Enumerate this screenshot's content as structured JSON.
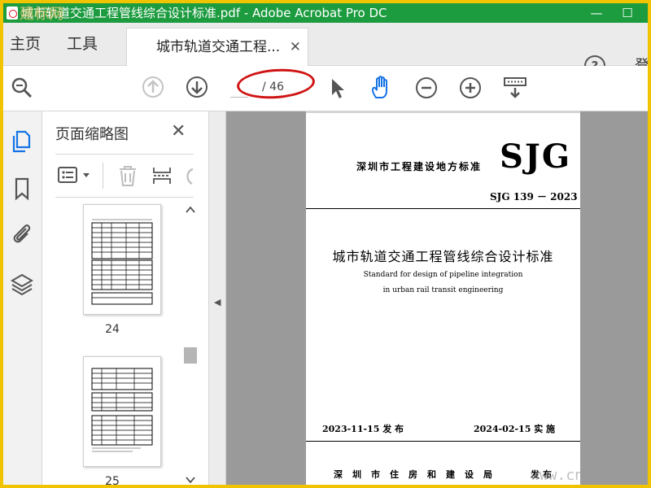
{
  "window": {
    "title": "城市轨道交通工程管线综合设计标准.pdf - Adobe Acrobat Pro DC",
    "watermark_overlay": "建标网",
    "minimize_glyph": "—",
    "maximize_glyph": "☐"
  },
  "tabs": {
    "home": "主页",
    "tools": "工具",
    "document": "城市轨道交通工程...",
    "close_glyph": "✕",
    "help_glyph": "?",
    "signin": "登"
  },
  "toolbar": {
    "current_page": "",
    "total_pages": "/ 46",
    "icons": [
      "zoom-search-icon",
      "prev-page-icon",
      "next-page-icon",
      "select-arrow-icon",
      "hand-tool-icon",
      "zoom-out-icon",
      "zoom-in-icon",
      "page-display-icon"
    ]
  },
  "sidebar": {
    "icons": [
      "page-thumbnails-icon",
      "bookmarks-icon",
      "attachments-icon",
      "layers-icon"
    ]
  },
  "thumbnails_panel": {
    "title": "页面缩略图",
    "close_glyph": "✕",
    "pages": [
      {
        "number": "24"
      },
      {
        "number": "25"
      }
    ]
  },
  "document_page": {
    "issuer": "深圳市工程建设地方标准",
    "logo": "SJG",
    "code": "SJG 139 － 2023",
    "title_cn": "城市轨道交通工程管线综合设计标准",
    "title_en_line1": "Standard for design of pipeline integration",
    "title_en_line2": "in urban rail transit engineering",
    "issue_date": "2023-11-15  发 布",
    "implement_date": "2024-02-15  实 施",
    "publisher": "深圳市住房和建设局",
    "publish_verb": "发布"
  },
  "site_watermark": "www.cn",
  "colors": {
    "title_bar": "#1c9b3f",
    "frame_border": "#f0c400",
    "annotation_circle": "#d01414",
    "hand_tool": "#1473e6",
    "thumbnails_icon": "#1473e6"
  }
}
